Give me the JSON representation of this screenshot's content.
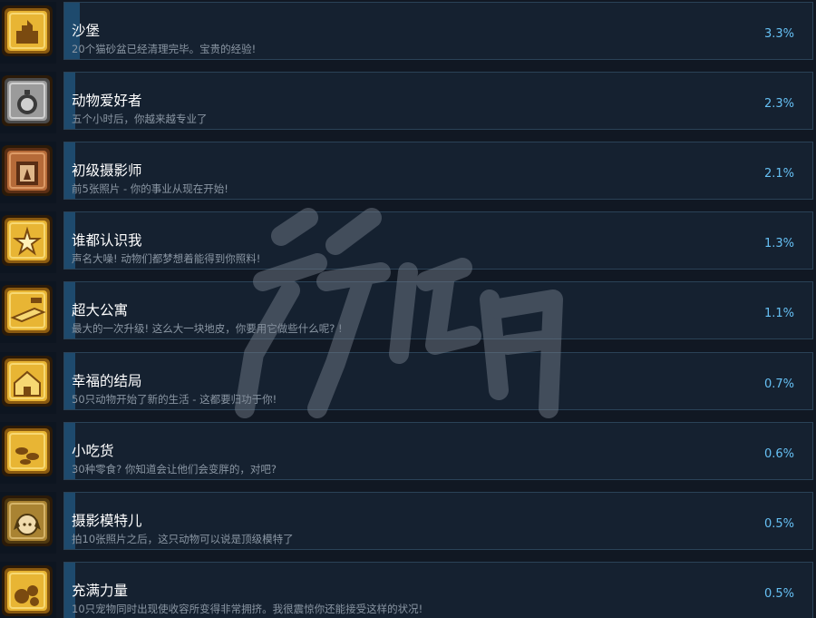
{
  "achievements": [
    {
      "title": "沙堡",
      "description": "20个猫砂盆已经清理完毕。宝贵的经验!",
      "percent": "3.3%",
      "progress": 0.033,
      "icon": "sandcastle-icon",
      "tone": "gold"
    },
    {
      "title": "动物爱好者",
      "description": "五个小时后，你越来越专业了",
      "percent": "2.3%",
      "progress": 0.023,
      "icon": "stopwatch-icon",
      "tone": "silver"
    },
    {
      "title": "初级摄影师",
      "description": "前5张照片 - 你的事业从现在开始!",
      "percent": "2.1%",
      "progress": 0.021,
      "icon": "photo-frame-icon",
      "tone": "bronze"
    },
    {
      "title": "谁都认识我",
      "description": "声名大噪! 动物们都梦想着能得到你照料!",
      "percent": "1.3%",
      "progress": 0.013,
      "icon": "shooting-star-icon",
      "tone": "gold"
    },
    {
      "title": "超大公寓",
      "description": "最大的一次升级! 这么大一块地皮，你要用它做些什么呢? !",
      "percent": "1.1%",
      "progress": 0.011,
      "icon": "floor-plate-icon",
      "tone": "gold"
    },
    {
      "title": "幸福的结局",
      "description": "50只动物开始了新的生活 - 这都要归功于你!",
      "percent": "0.7%",
      "progress": 0.007,
      "icon": "house-icon",
      "tone": "gold"
    },
    {
      "title": "小吃货",
      "description": "30种零食? 你知道会让他们会变胖的，对吧?",
      "percent": "0.6%",
      "progress": 0.006,
      "icon": "snacks-icon",
      "tone": "gold"
    },
    {
      "title": "摄影模特儿",
      "description": "拍10张照片之后，这只动物可以说是顶级模特了",
      "percent": "0.5%",
      "progress": 0.005,
      "icon": "dog-face-icon",
      "tone": "darkgold"
    },
    {
      "title": "充满力量",
      "description": "10只宠物同时出现使收容所变得非常拥挤。我很震惊你还能接受这样的状况!",
      "percent": "0.5%",
      "progress": 0.005,
      "icon": "pets-group-icon",
      "tone": "gold"
    }
  ],
  "watermark": {
    "text": "游侠网"
  },
  "colors": {
    "background": "#111823",
    "panel": "#152130",
    "progress": "#1e4a6d",
    "percent": "#66c0f4",
    "gold": "#e8b534",
    "silver": "#9b9b9b",
    "bronze": "#b56a38"
  }
}
